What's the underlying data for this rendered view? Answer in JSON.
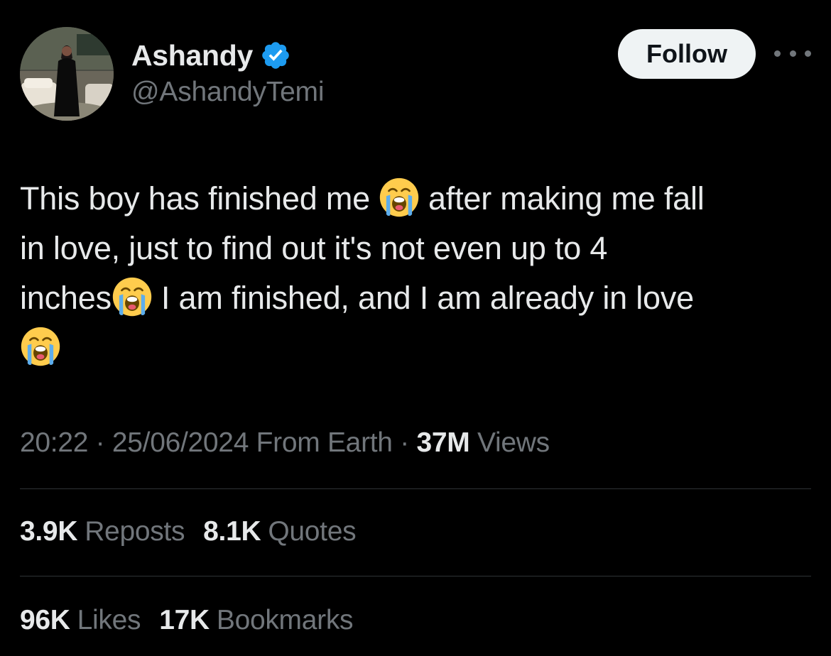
{
  "author": {
    "display_name": "Ashandy",
    "handle": "@AshandyTemi",
    "verified": true,
    "avatar": "profile-photo"
  },
  "actions": {
    "follow_label": "Follow",
    "more_icon": "more-horizontal-icon"
  },
  "tweet": {
    "text": "This boy has finished me 😭 after making me fall in love, just to find out it's not even up to 4 inches😭 I am finished, and I am already in love 😭",
    "segments": {
      "l1a": "This boy has finished me",
      "l1b": "after making me fall",
      "l2": "in love, just to find out it's not even up to 4",
      "l3a": "inches",
      "l3b": "I am finished, and I am already in love"
    },
    "emoji": "loudly-crying-face"
  },
  "meta": {
    "time": "20:22",
    "date": "25/06/2024",
    "source": "From Earth",
    "separator": "·",
    "views_count": "37M",
    "views_label": "Views"
  },
  "stats": {
    "reposts_count": "3.9K",
    "reposts_label": "Reposts",
    "quotes_count": "8.1K",
    "quotes_label": "Quotes",
    "likes_count": "96K",
    "likes_label": "Likes",
    "bookmarks_count": "17K",
    "bookmarks_label": "Bookmarks"
  },
  "colors": {
    "background": "#000000",
    "text_primary": "#e7e9ea",
    "text_secondary": "#71767b",
    "divider": "#2f3336",
    "verified_blue": "#1d9bf0",
    "follow_bg": "#eff3f4"
  }
}
